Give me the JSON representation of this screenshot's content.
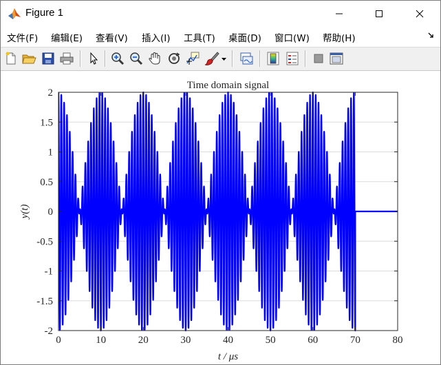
{
  "window": {
    "title": "Figure 1",
    "icon": "matlab-icon",
    "controls": [
      "minimize-icon",
      "maximize-icon",
      "close-icon"
    ]
  },
  "menu": {
    "items": [
      "文件(F)",
      "编辑(E)",
      "查看(V)",
      "插入(I)",
      "工具(T)",
      "桌面(D)",
      "窗口(W)",
      "帮助(H)"
    ],
    "dock_arrow_icon": "dock-arrow-icon"
  },
  "toolbar": {
    "buttons": [
      "new-figure-icon",
      "open-file-icon",
      "save-icon",
      "print-icon",
      "edit-plot-icon",
      "zoom-in-icon",
      "zoom-out-icon",
      "pan-icon",
      "rotate-3d-icon",
      "data-cursor-icon",
      "brush-icon",
      "link-plot-icon",
      "colorbar-icon",
      "legend-icon",
      "hide-plot-tools-icon",
      "show-plot-tools-icon"
    ]
  },
  "colors": {
    "line": "#0000ff",
    "grid": "#dcdcdc",
    "axes": "#262626"
  },
  "chart_data": {
    "type": "line",
    "title": "Time domain signal",
    "xlabel": "t / μs",
    "ylabel": "y(t)",
    "xlim": [
      0,
      80
    ],
    "ylim": [
      -2,
      2
    ],
    "xticks": [
      0,
      10,
      20,
      30,
      40,
      50,
      60,
      70,
      80
    ],
    "yticks": [
      -2,
      -1.5,
      -1,
      -0.5,
      0,
      0.5,
      1,
      1.5,
      2
    ],
    "xtick_labels": [
      "0",
      "10",
      "20",
      "30",
      "40",
      "50",
      "60",
      "70",
      "80"
    ],
    "ytick_labels": [
      "-2",
      "-1.5",
      "-1",
      "-0.5",
      "0",
      "0.5",
      "1",
      "1.5",
      "2"
    ],
    "grid": true,
    "series": [
      {
        "signal_end": 70,
        "envelope_period": 20,
        "envelope_peak": 2,
        "carrier_frequency_per_us": 1.5,
        "envelope_peaks_at": [
          0,
          20,
          40,
          60
        ],
        "envelope_nulls_at": [
          10,
          30,
          50,
          70
        ],
        "after_end_value": 0
      }
    ]
  }
}
